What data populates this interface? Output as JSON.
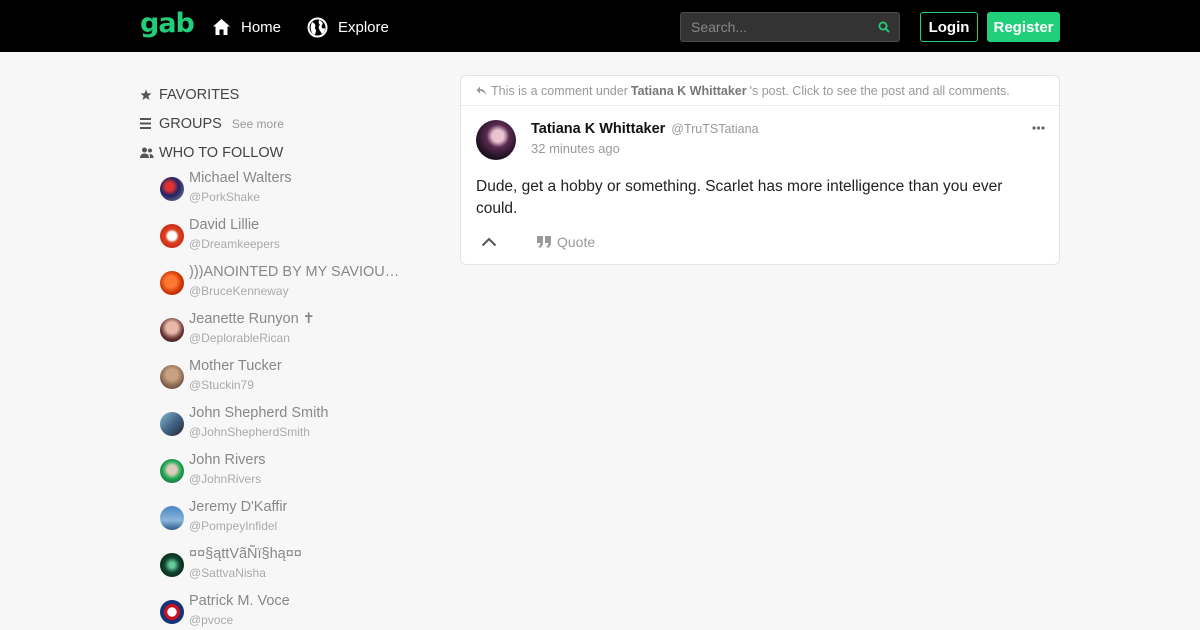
{
  "header": {
    "logo": "gab",
    "nav": [
      {
        "label": "Home",
        "icon": "home-icon"
      },
      {
        "label": "Explore",
        "icon": "globe-icon"
      }
    ],
    "search": {
      "placeholder": "Search..."
    },
    "login_label": "Login",
    "register_label": "Register"
  },
  "colors": {
    "accent": "#21cf7a",
    "topbar": "#000000",
    "background": "#f7f7f7"
  },
  "sidebar": {
    "favorites": "FAVORITES",
    "groups": "GROUPS",
    "see_more": "See more",
    "who_to_follow": "WHO TO FOLLOW",
    "follow": [
      {
        "name": "Michael Walters",
        "handle": "@PorkShake"
      },
      {
        "name": "David Lillie",
        "handle": "@Dreamkeepers"
      },
      {
        "name": ")))ANOINTED BY MY SAVIOUR...",
        "handle": "@BruceKenneway"
      },
      {
        "name": "Jeanette Runyon ✝",
        "handle": "@DeplorableRican"
      },
      {
        "name": "Mother Tucker",
        "handle": "@Stuckin79"
      },
      {
        "name": "John Shepherd Smith",
        "handle": "@JohnShepherdSmith"
      },
      {
        "name": "John Rivers",
        "handle": "@JohnRivers"
      },
      {
        "name": "Jeremy D'Kaffir",
        "handle": "@PompeyInfidel"
      },
      {
        "name": "¤¤§ąttVãÑï§hą¤¤",
        "handle": "@SattvaNisha"
      },
      {
        "name": "Patrick M. Voce",
        "handle": "@pvoce"
      }
    ]
  },
  "post": {
    "notice_prefix": "This is a comment under",
    "notice_author": "Tatiana K Whittaker",
    "notice_suffix": "'s post. Click to see the post and all comments.",
    "author": "Tatiana K Whittaker",
    "handle": "@TruTSTatiana",
    "time": "32 minutes ago",
    "body": "Dude, get a hobby or something. Scarlet has more intelligence than you ever could.",
    "quote_label": "Quote"
  }
}
